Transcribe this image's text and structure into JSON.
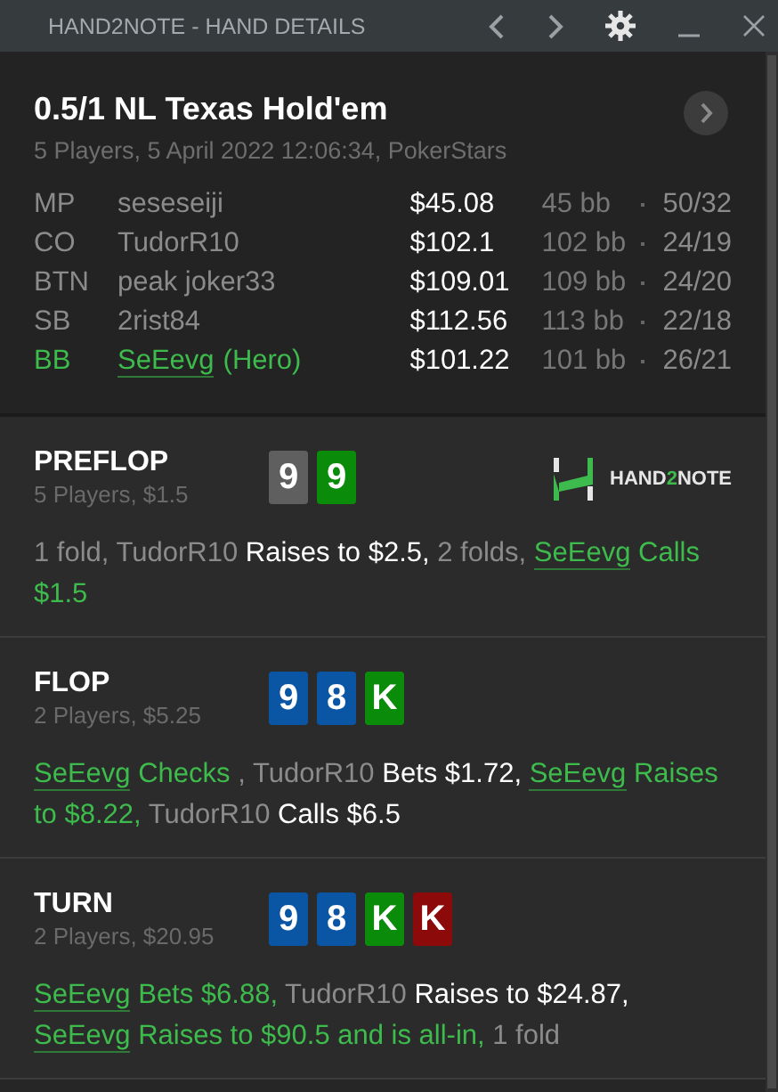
{
  "window": {
    "title": "HAND2NOTE - HAND DETAILS"
  },
  "hand": {
    "title": "0.5/1 NL Texas Hold'em",
    "subtitle": "5 Players, 5 April 2022 12:06:34, PokerStars"
  },
  "players": [
    {
      "position": "MP",
      "name": "seseseiji",
      "hero": false,
      "stack": "$45.08",
      "bb": "45 bb",
      "stats": "50/32"
    },
    {
      "position": "CO",
      "name": "TudorR10",
      "hero": false,
      "stack": "$102.1",
      "bb": "102 bb",
      "stats": "24/19"
    },
    {
      "position": "BTN",
      "name": "peak joker33",
      "hero": false,
      "stack": "$109.01",
      "bb": "109 bb",
      "stats": "24/20"
    },
    {
      "position": "SB",
      "name": "2rist84",
      "hero": false,
      "stack": "$112.56",
      "bb": "113 bb",
      "stats": "22/18"
    },
    {
      "position": "BB",
      "name": "SeEevg",
      "tag": "(Hero)",
      "hero": true,
      "stack": "$101.22",
      "bb": "101 bb",
      "stats": "26/21"
    }
  ],
  "logo": [
    {
      "text": "HAND",
      "accent": false
    },
    {
      "text": "2",
      "accent": true
    },
    {
      "text": "NOTE",
      "accent": false
    }
  ],
  "streets": [
    {
      "name": "PREFLOP",
      "info": "5 Players, $1.5",
      "logo": true,
      "cards": [
        {
          "rank": "9",
          "color": "#5f5f5f"
        },
        {
          "rank": "9",
          "color": "#0a8c0a"
        }
      ],
      "actions": [
        {
          "text": "1 fold, TudorR10 ",
          "kind": "muted"
        },
        {
          "text": "Raises to $2.5,",
          "kind": "action"
        },
        {
          "text": " 2 folds, ",
          "kind": "muted"
        },
        {
          "text": "SeEevg",
          "kind": "hero-link"
        },
        {
          "text": " Calls $1.5",
          "kind": "hero"
        }
      ]
    },
    {
      "name": "FLOP",
      "info": "2 Players, $5.25",
      "logo": false,
      "cards": [
        {
          "rank": "9",
          "color": "#0b56a4"
        },
        {
          "rank": "8",
          "color": "#0b56a4"
        },
        {
          "rank": "K",
          "color": "#0a8c0a"
        }
      ],
      "actions": [
        {
          "text": "SeEevg",
          "kind": "hero-link"
        },
        {
          "text": " Checks ",
          "kind": "hero"
        },
        {
          "text": ", TudorR10 ",
          "kind": "muted"
        },
        {
          "text": "Bets $1.72, ",
          "kind": "action"
        },
        {
          "text": "SeEevg",
          "kind": "hero-link"
        },
        {
          "text": " Raises to $8.22,",
          "kind": "hero"
        },
        {
          "text": " TudorR10 ",
          "kind": "muted"
        },
        {
          "text": "Calls $6.5",
          "kind": "action"
        }
      ]
    },
    {
      "name": "TURN",
      "info": "2 Players, $20.95",
      "logo": false,
      "cards": [
        {
          "rank": "9",
          "color": "#0b56a4"
        },
        {
          "rank": "8",
          "color": "#0b56a4"
        },
        {
          "rank": "K",
          "color": "#0a8c0a"
        },
        {
          "rank": "K",
          "color": "#8c0a0a"
        }
      ],
      "actions": [
        {
          "text": "SeEevg",
          "kind": "hero-link"
        },
        {
          "text": " Bets $6.88,",
          "kind": "hero"
        },
        {
          "text": " TudorR10 ",
          "kind": "muted"
        },
        {
          "text": "Raises to $24.87, ",
          "kind": "action"
        },
        {
          "text": "SeEevg",
          "kind": "hero-link"
        },
        {
          "text": " Raises to $90.5 and is all-in,",
          "kind": "hero"
        },
        {
          "text": " 1 fold",
          "kind": "muted"
        }
      ]
    }
  ]
}
